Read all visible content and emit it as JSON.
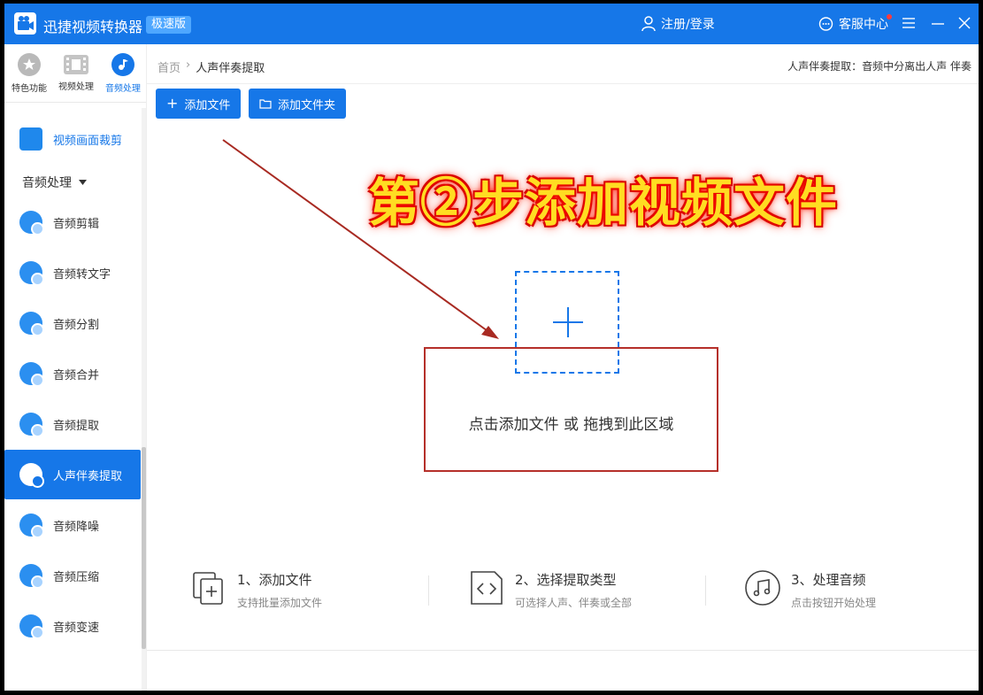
{
  "app": {
    "name": "迅捷视频转换器",
    "badge": "极速版",
    "login": "注册/登录",
    "service": "客服中心"
  },
  "categories": [
    {
      "label": "特色功能",
      "icon": "star-icon"
    },
    {
      "label": "视频处理",
      "icon": "film-icon"
    },
    {
      "label": "音频处理",
      "icon": "music-icon"
    }
  ],
  "sidebar": {
    "top_item": "视频画面裁剪",
    "group": "音频处理",
    "items": [
      {
        "label": "音频剪辑"
      },
      {
        "label": "音频转文字"
      },
      {
        "label": "音频分割"
      },
      {
        "label": "音频合并"
      },
      {
        "label": "音频提取"
      },
      {
        "label": "人声伴奏提取"
      },
      {
        "label": "音频降噪"
      },
      {
        "label": "音频压缩"
      },
      {
        "label": "音频变速"
      }
    ],
    "active_index": 5
  },
  "breadcrumb": {
    "home": "首页",
    "current": "人声伴奏提取"
  },
  "description": "人声伴奏提取：音频中分离出人声 伴奏",
  "toolbar": {
    "add_file": "添加文件",
    "add_folder": "添加文件夹"
  },
  "annotation": "第②步添加视频文件",
  "drop_zone": {
    "text": "点击添加文件 或 拖拽到此区域"
  },
  "steps": [
    {
      "title": "1、添加文件",
      "sub": "支持批量添加文件",
      "icon": "file-add-icon"
    },
    {
      "title": "2、选择提取类型",
      "sub": "可选择人声、伴奏或全部",
      "icon": "code-file-icon"
    },
    {
      "title": "3、处理音频",
      "sub": "点击按钮开始处理",
      "icon": "music-note-icon"
    }
  ],
  "colors": {
    "primary": "#1677e8",
    "annotation": "#ffdd22",
    "annotation_glow": "#ff0000",
    "highlight_box": "#b5302a"
  }
}
